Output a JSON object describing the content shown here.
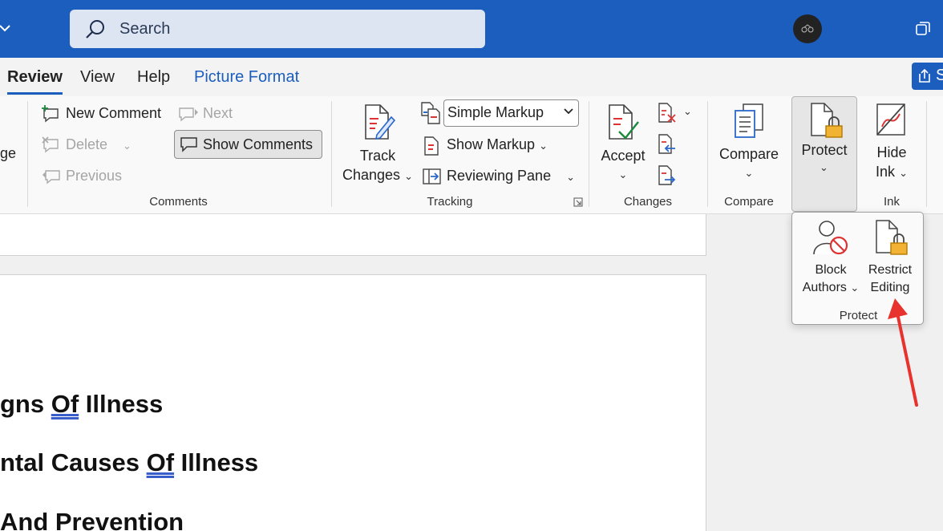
{
  "titlebar": {
    "search_placeholder": "Search",
    "brand_color": "#1b5ebe"
  },
  "tabs": [
    {
      "label": "Review",
      "active": true
    },
    {
      "label": "View"
    },
    {
      "label": "Help"
    },
    {
      "label": "Picture Format"
    }
  ],
  "share_label": "S",
  "ribbon": {
    "partial_left_label": "ge",
    "comments": {
      "new_comment": "New Comment",
      "delete": "Delete",
      "previous": "Previous",
      "next": "Next",
      "show_comments": "Show Comments",
      "group_label": "Comments"
    },
    "tracking": {
      "track_changes_line1": "Track",
      "track_changes_line2": "Changes",
      "markup_selected": "Simple Markup",
      "show_markup": "Show Markup",
      "reviewing_pane": "Reviewing Pane",
      "group_label": "Tracking"
    },
    "changes": {
      "accept": "Accept",
      "group_label": "Changes"
    },
    "compare": {
      "compare": "Compare",
      "group_label": "Compare"
    },
    "protect": {
      "protect": "Protect"
    },
    "ink": {
      "hide_ink_line1": "Hide",
      "hide_ink_line2": "Ink",
      "group_label": "Ink"
    }
  },
  "protect_popup": {
    "block_authors_line1": "Block",
    "block_authors_line2": "Authors",
    "restrict_editing_line1": "Restrict",
    "restrict_editing_line2": "Editing",
    "group_label": "Protect"
  },
  "document": {
    "headings": [
      {
        "before": "gns ",
        "underlined": "Of",
        "after": " Illness"
      },
      {
        "before": "ntal Causes ",
        "underlined": "Of",
        "after": " Illness"
      },
      {
        "before": "And Prevention",
        "underlined": "",
        "after": ""
      }
    ]
  },
  "annotation": {
    "arrow_color": "#e8322e"
  }
}
